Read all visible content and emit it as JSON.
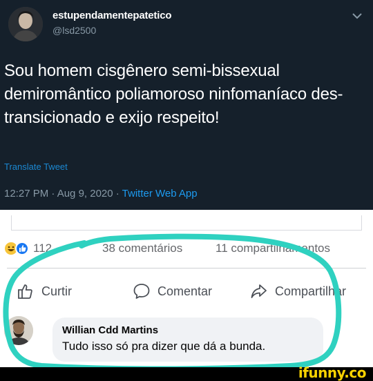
{
  "tweet": {
    "display_name": "estupendamentepatetico",
    "handle": "@lsd2500",
    "text": "Sou homem cisgênero semi-bissexual demiromântico poliamoroso ninfomaníaco des-transicionado e exijo respeito!",
    "translate_label": "Translate Tweet",
    "time_date": "12:27 PM · Aug 9, 2020 · ",
    "source": "Twitter Web App"
  },
  "facebook": {
    "reactions_count": "112",
    "comments": "38 comentários",
    "shares": "11 compartilhamentos",
    "actions": {
      "like": "Curtir",
      "comment": "Comentar",
      "share": "Compartilhar"
    },
    "comment": {
      "author": "Willian Cdd Martins",
      "text": "Tudo isso só pra dizer que dá a bunda."
    }
  },
  "watermark": "ifunny.co",
  "colors": {
    "tweet_bg": "#15202b",
    "link_blue": "#1d9bf0",
    "highlight": "#2fd1c0",
    "watermark": "#f8d200"
  }
}
